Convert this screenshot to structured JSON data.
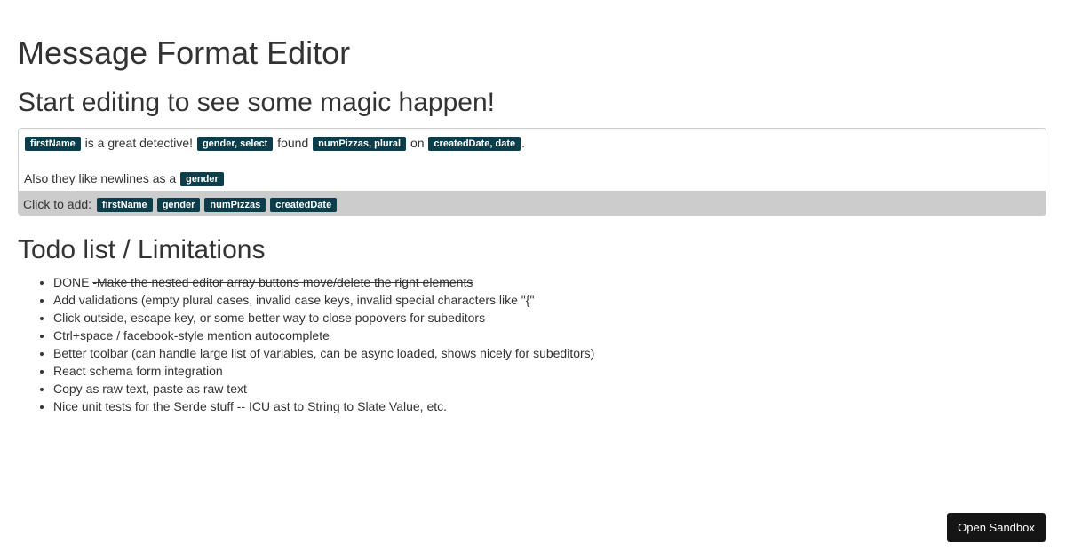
{
  "header": {
    "title": "Message Format Editor",
    "subtitle": "Start editing to see some magic happen!"
  },
  "editor": {
    "line1": {
      "tag1": "firstName",
      "text1": " is a great detective! ",
      "tag2": "gender, select",
      "text2": " found ",
      "tag3": "numPizzas, plural",
      "text3": " on ",
      "tag4": "createdDate, date",
      "text4": "."
    },
    "line2": {
      "text1": "Also they like newlines as a ",
      "tag1": "gender"
    }
  },
  "toolbar": {
    "label": "Click to add:",
    "variables": [
      "firstName",
      "gender",
      "numPizzas",
      "createdDate"
    ]
  },
  "todo": {
    "title": "Todo list / Limitations",
    "items": [
      {
        "prefix": "DONE ",
        "struck": "-Make the nested editor array buttons move/delete the right elements"
      },
      {
        "text": "Add validations (empty plural cases, invalid case keys, invalid special characters like \"{\""
      },
      {
        "text": "Click outside, escape key, or some better way to close popovers for subeditors"
      },
      {
        "text": "Ctrl+space / facebook-style mention autocomplete"
      },
      {
        "text": "Better toolbar (can handle large list of variables, can be async loaded, shows nicely for subeditors)"
      },
      {
        "text": "React schema form integration"
      },
      {
        "text": "Copy as raw text, paste as raw text"
      },
      {
        "text": "Nice unit tests for the Serde stuff -- ICU ast to String to Slate Value, etc."
      }
    ]
  },
  "sandbox": {
    "label": "Open Sandbox"
  },
  "colors": {
    "tag_background": "#0b3d4b",
    "toolbar_background": "#cccccc",
    "sandbox_background": "#151515"
  }
}
